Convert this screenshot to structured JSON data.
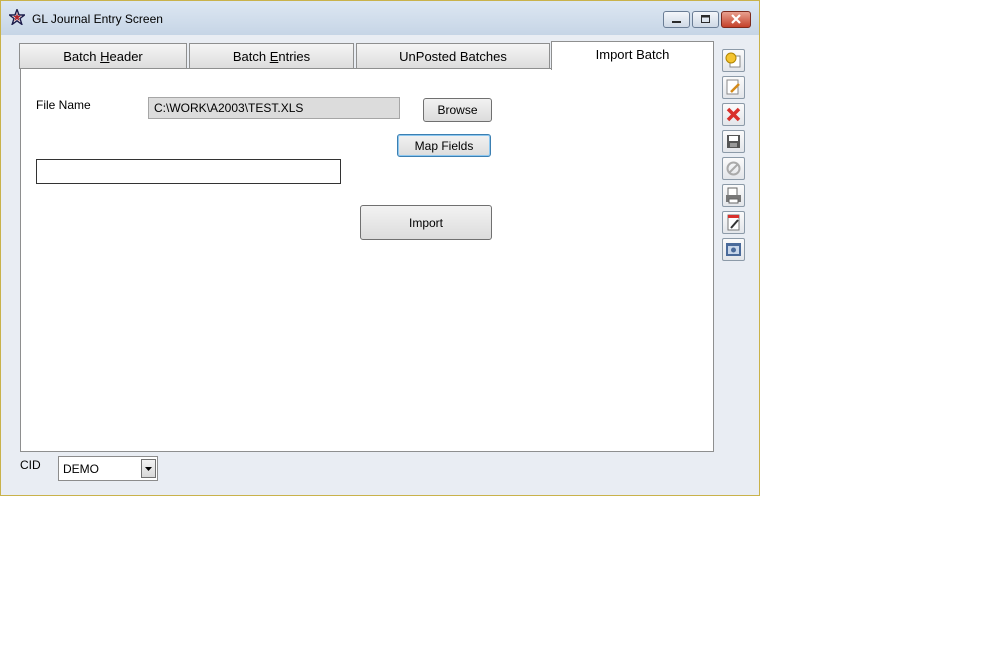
{
  "window": {
    "title": "GL Journal Entry Screen"
  },
  "tabs": [
    {
      "pre": "Batch ",
      "accel": "H",
      "post": "eader"
    },
    {
      "pre": "Batch ",
      "accel": "E",
      "post": "ntries"
    },
    {
      "pre": "UnPosted Batches",
      "accel": "",
      "post": ""
    },
    {
      "pre": "Import Batch",
      "accel": "",
      "post": ""
    }
  ],
  "import_panel": {
    "file_name_label": "File Name",
    "file_name_value": "C:\\WORK\\A2003\\TEST.XLS",
    "browse_label": "Browse",
    "map_fields_label": "Map Fields",
    "status_value": "",
    "import_label": "Import"
  },
  "footer": {
    "cid_label": "CID",
    "cid_value": "DEMO"
  },
  "toolbar": [
    "add-record-icon",
    "edit-record-icon",
    "delete-icon",
    "save-icon",
    "cancel-icon",
    "print-preview-icon",
    "report-icon",
    "close-form-icon"
  ],
  "colors": {
    "title_bar": "#c6d5e6",
    "window_border": "#c9b24a",
    "client_bg": "#e9edf3",
    "close_button": "#c4412a"
  }
}
